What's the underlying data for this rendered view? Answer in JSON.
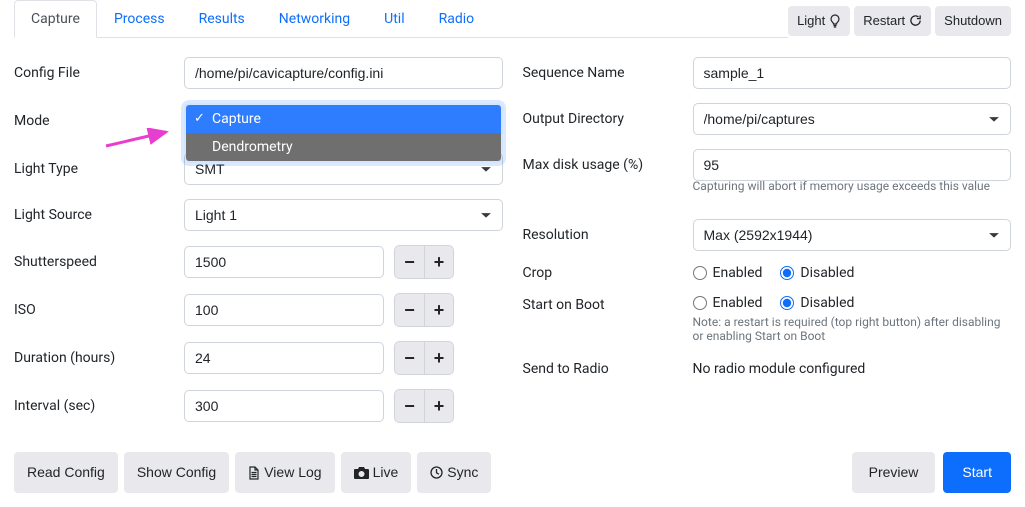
{
  "tabs": [
    "Capture",
    "Process",
    "Results",
    "Networking",
    "Util",
    "Radio"
  ],
  "activeTab": 0,
  "topButtons": {
    "light": "Light",
    "restart": "Restart",
    "shutdown": "Shutdown"
  },
  "left": {
    "configFile": {
      "label": "Config File",
      "value": "/home/pi/cavicapture/config.ini"
    },
    "mode": {
      "label": "Mode",
      "selected": "Capture",
      "options": [
        "Capture",
        "Dendrometry"
      ]
    },
    "lightType": {
      "label": "Light Type",
      "value": "SMT"
    },
    "lightSource": {
      "label": "Light Source",
      "value": "Light 1"
    },
    "shutterspeed": {
      "label": "Shutterspeed",
      "value": "1500"
    },
    "iso": {
      "label": "ISO",
      "value": "100"
    },
    "duration": {
      "label": "Duration (hours)",
      "value": "24"
    },
    "interval": {
      "label": "Interval (sec)",
      "value": "300"
    }
  },
  "right": {
    "sequenceName": {
      "label": "Sequence Name",
      "value": "sample_1"
    },
    "outputDir": {
      "label": "Output Directory",
      "value": "/home/pi/captures"
    },
    "maxDisk": {
      "label": "Max disk usage (%)",
      "value": "95",
      "helper": "Capturing will abort if memory usage exceeds this value"
    },
    "resolution": {
      "label": "Resolution",
      "value": "Max (2592x1944)"
    },
    "crop": {
      "label": "Crop",
      "enabled": "Enabled",
      "disabled": "Disabled",
      "value": "disabled"
    },
    "startOnBoot": {
      "label": "Start on Boot",
      "enabled": "Enabled",
      "disabled": "Disabled",
      "value": "disabled",
      "note": "Note: a restart is required (top right button) after disabling or enabling Start on Boot"
    },
    "sendRadio": {
      "label": "Send to Radio",
      "value": "No radio module configured"
    }
  },
  "bottom": {
    "readConfig": "Read Config",
    "showConfig": "Show Config",
    "viewLog": "View Log",
    "live": "Live",
    "sync": "Sync",
    "preview": "Preview",
    "start": "Start"
  }
}
